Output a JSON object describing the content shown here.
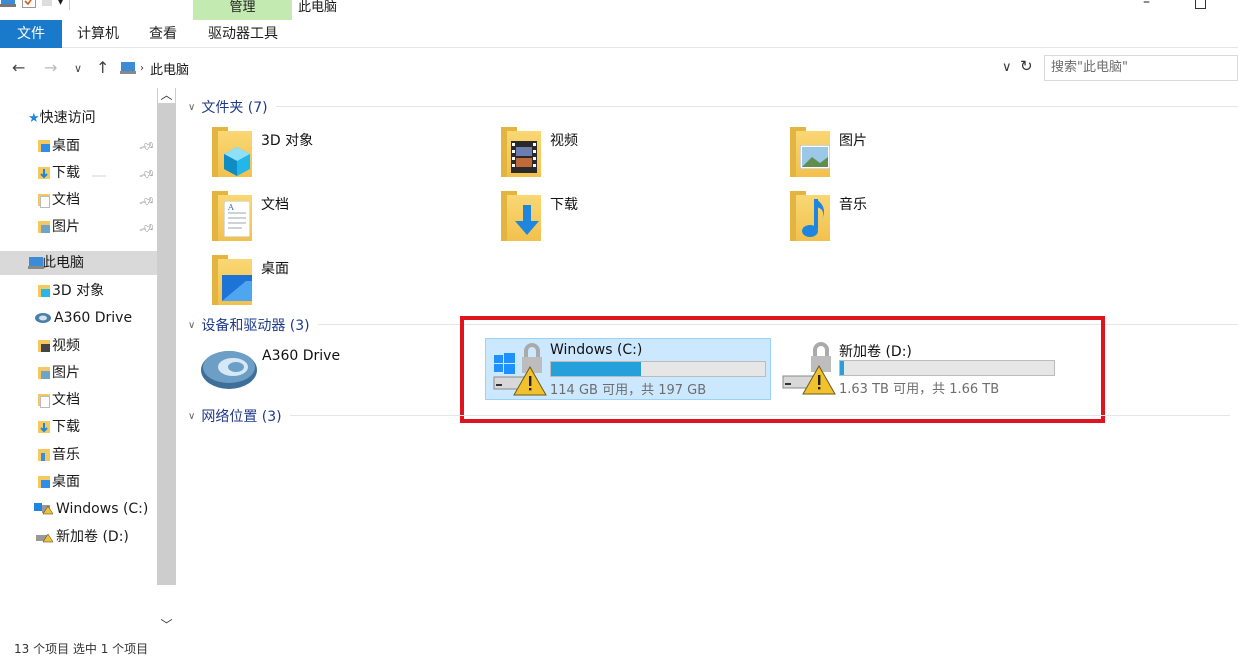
{
  "window": {
    "title": "此电脑",
    "context_tab": "管理",
    "minimize_glyph": "–"
  },
  "ribbon": {
    "tabs": [
      "文件",
      "计算机",
      "查看",
      "驱动器工具"
    ]
  },
  "address": {
    "path": "此电脑",
    "search_placeholder": "搜索\"此电脑\""
  },
  "navpane": {
    "quick_access": "快速访问",
    "quick_items": [
      "桌面",
      "下载",
      "文档",
      "图片"
    ],
    "this_pc": "此电脑",
    "pc_items": [
      "3D 对象",
      "A360 Drive",
      "视频",
      "图片",
      "文档",
      "下载",
      "音乐",
      "桌面",
      "Windows (C:)",
      "新加卷 (D:)"
    ]
  },
  "content": {
    "folders_header": "文件夹 (7)",
    "folders": [
      "3D 对象",
      "视频",
      "图片",
      "文档",
      "下载",
      "音乐",
      "桌面"
    ],
    "devices_header": "设备和驱动器 (3)",
    "a360": "A360 Drive",
    "drives": [
      {
        "name": "Windows (C:)",
        "free_text": "114 GB 可用，共 197 GB",
        "used_fraction": 0.42
      },
      {
        "name": "新加卷 (D:)",
        "free_text": "1.63 TB 可用，共 1.66 TB",
        "used_fraction": 0.02
      }
    ],
    "network_header": "网络位置 (3)"
  },
  "statusbar": {
    "text": "13 个项目    选中 1 个项目"
  },
  "colors": {
    "file_tab": "#1979ca",
    "manage_tab": "#c3eab1",
    "drive_fill": "#26a0da",
    "highlight": "#e0141e",
    "selection": "#cce8ff"
  }
}
